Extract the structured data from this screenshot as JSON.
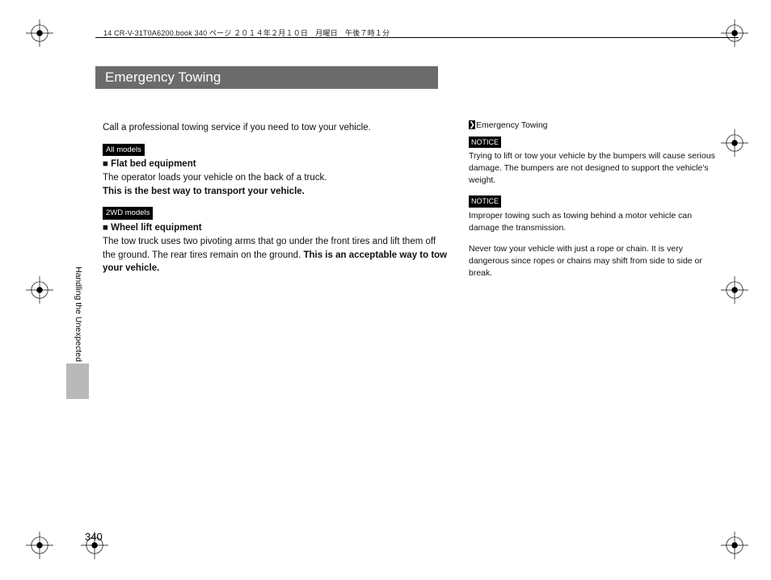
{
  "meta": {
    "header": "14 CR-V-31T0A6200.book  340 ページ  ２０１４年２月１０日　月曜日　午後７時１分"
  },
  "title": "Emergency Towing",
  "sectionLabel": "Handling the Unexpected",
  "pageNumber": "340",
  "left": {
    "intro": "Call a professional towing service if you need to tow your vehicle.",
    "tag1": "All models",
    "h1": "■ Flat bed equipment",
    "p1a": "The operator loads your vehicle on the back of a truck.",
    "p1b": "This is the best way to transport your vehicle.",
    "tag2": "2WD models",
    "h2": "■ Wheel lift equipment",
    "p2a": "The tow truck uses two pivoting arms that go under the front tires and lift them off the ground. The rear tires remain on the ground. ",
    "p2b": "This is an acceptable way to tow your vehicle."
  },
  "right": {
    "heading": "Emergency Towing",
    "notice": "NOTICE",
    "n1": "Trying to lift or tow your vehicle by the bumpers will cause serious damage. The bumpers are not designed to support the vehicle's weight.",
    "n2": "Improper towing such as towing behind a motor vehicle can damage the transmission.",
    "p3": "Never tow your vehicle with just a rope or chain. It is very dangerous since ropes or chains may shift from side to side or break."
  }
}
